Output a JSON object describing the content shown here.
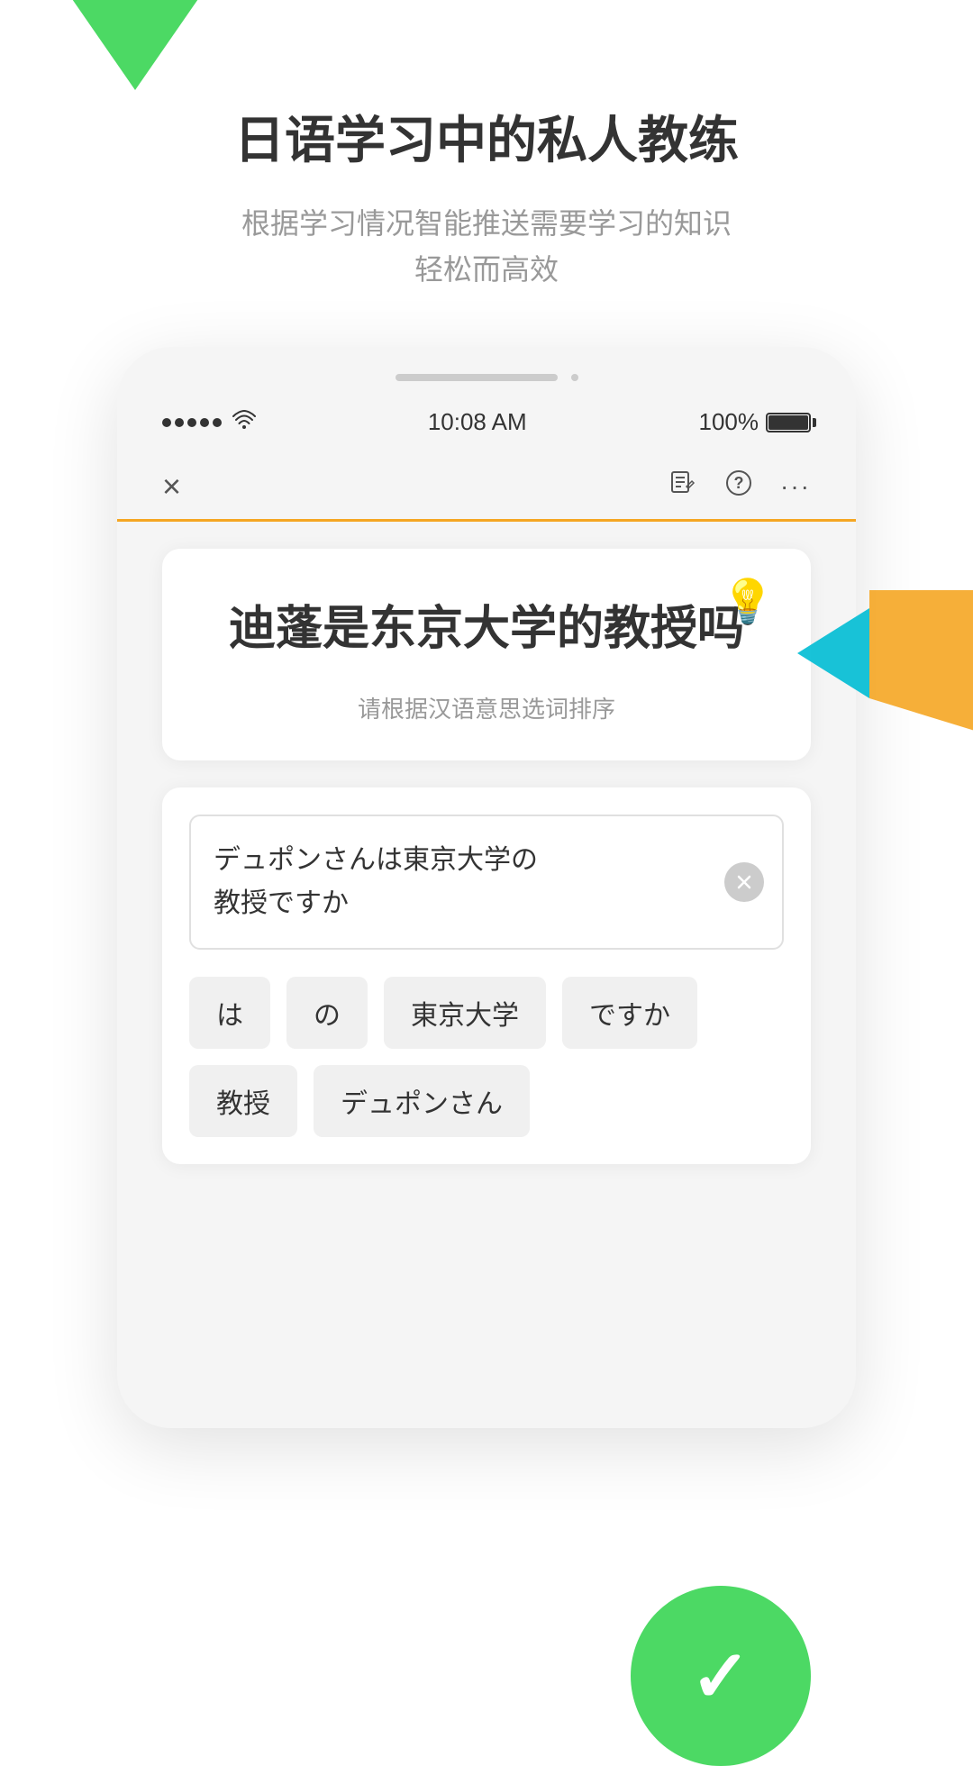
{
  "app": {
    "logo_color": "#4cd964"
  },
  "header": {
    "main_title": "日语学习中的私人教练",
    "subtitle_line1": "根据学习情况智能推送需要学习的知识",
    "subtitle_line2": "轻松而高效"
  },
  "status_bar": {
    "time": "10:08 AM",
    "battery_percent": "100%"
  },
  "navbar": {
    "close_icon": "×",
    "icons": [
      "✏",
      "?",
      "•••"
    ]
  },
  "question_card": {
    "question_text": "迪蓬是东京大学的教授吗",
    "hint_text": "请根据汉语意思选词排序",
    "lightbulb": "💡"
  },
  "answer_card": {
    "input_text_line1": "デュポンさんは東京大学の",
    "input_text_line2": "教授ですか",
    "word_chips": [
      "は",
      "の",
      "東京大学",
      "ですか",
      "教授",
      "デュポンさん"
    ]
  }
}
